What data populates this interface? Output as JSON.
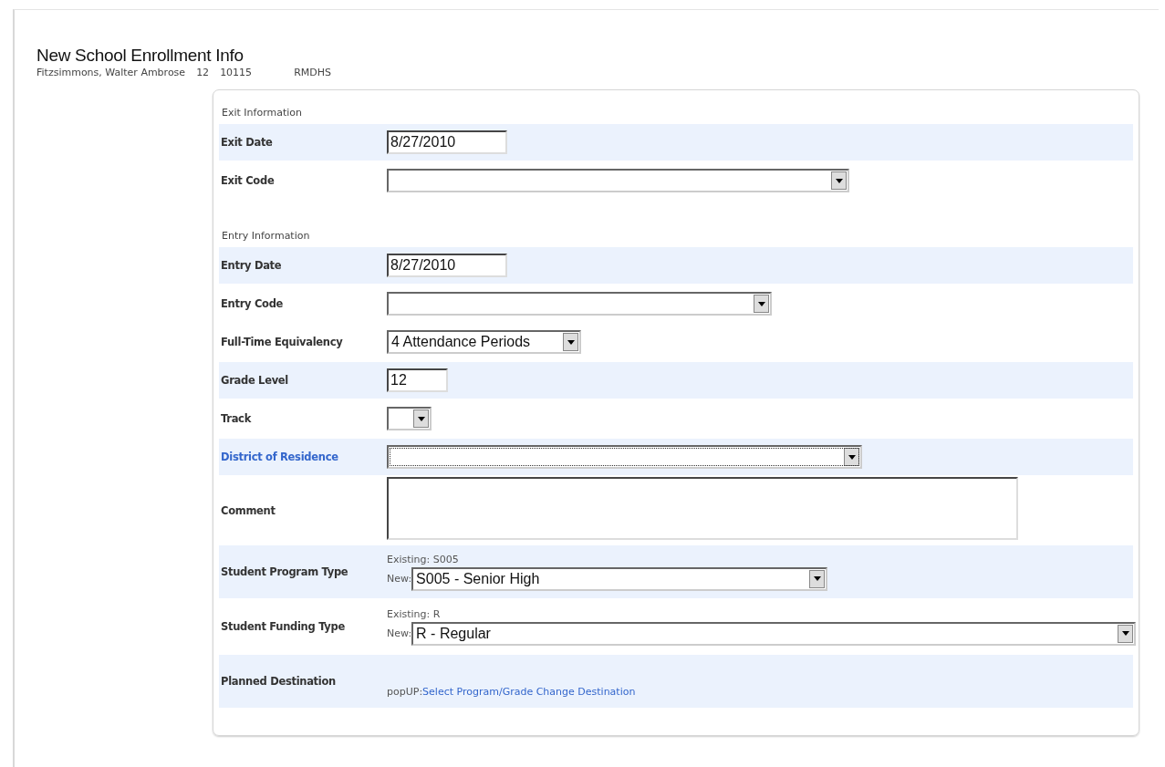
{
  "title": "New School Enrollment Info",
  "student": {
    "name": "Fitzsimmons, Walter Ambrose",
    "grade": "12",
    "id": "10115",
    "school": "RMDHS"
  },
  "sections": [
    {
      "heading": "Exit Information",
      "rows": [
        {
          "label": "Exit Date",
          "kind": "text",
          "value": "8/27/2010",
          "shaded": true,
          "label_link": false
        },
        {
          "label": "Exit Code",
          "kind": "select",
          "value": "",
          "shaded": false,
          "label_link": false,
          "focused": false
        }
      ]
    },
    {
      "heading": "Entry Information",
      "rows": [
        {
          "label": "Entry Date",
          "kind": "text",
          "value": "8/27/2010",
          "shaded": true,
          "label_link": false
        },
        {
          "label": "Entry Code",
          "kind": "select",
          "value": "",
          "shaded": false,
          "label_link": false,
          "focused": false
        },
        {
          "label": "Full-Time Equivalency",
          "kind": "select",
          "value": "4 Attendance Periods",
          "shaded": false,
          "label_link": false,
          "focused": false
        },
        {
          "label": "Grade Level",
          "kind": "text",
          "value": "12",
          "shaded": true,
          "label_link": false
        },
        {
          "label": "Track",
          "kind": "select",
          "value": "",
          "shaded": false,
          "label_link": false,
          "focused": false
        },
        {
          "label": "District of Residence",
          "kind": "select",
          "value": "",
          "shaded": true,
          "label_link": true,
          "focused": true
        },
        {
          "label": "Comment",
          "kind": "textarea",
          "value": "",
          "shaded": false,
          "label_link": false
        },
        {
          "label": "Student Program Type",
          "kind": "program",
          "existing": "Existing: S005",
          "new_label": "New:",
          "value": "S005 - Senior High",
          "shaded": true,
          "label_link": false
        },
        {
          "label": "Student Funding Type",
          "kind": "program",
          "existing": "Existing: R",
          "new_label": "New:",
          "value": "R - Regular",
          "shaded": false,
          "label_link": false
        },
        {
          "label": "Planned Destination",
          "kind": "link",
          "prefix": "popUP:",
          "link": "Select Program/Grade Change Destination",
          "shaded": true,
          "label_link": false
        }
      ]
    }
  ]
}
